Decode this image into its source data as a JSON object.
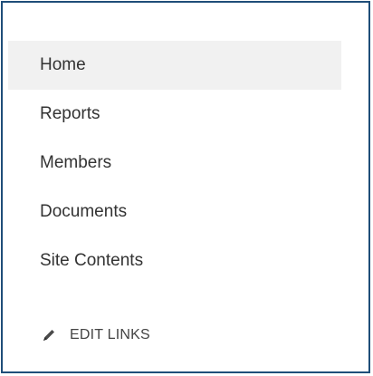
{
  "nav": {
    "items": [
      {
        "label": "Home",
        "selected": true
      },
      {
        "label": "Reports",
        "selected": false
      },
      {
        "label": "Members",
        "selected": false
      },
      {
        "label": "Documents",
        "selected": false
      },
      {
        "label": "Site Contents",
        "selected": false
      }
    ]
  },
  "edit_links": {
    "label": "EDIT LINKS",
    "icon": "pencil-icon"
  },
  "colors": {
    "frame_border": "#1f4e79",
    "selected_bg": "#f1f1f1",
    "text": "#333333"
  }
}
